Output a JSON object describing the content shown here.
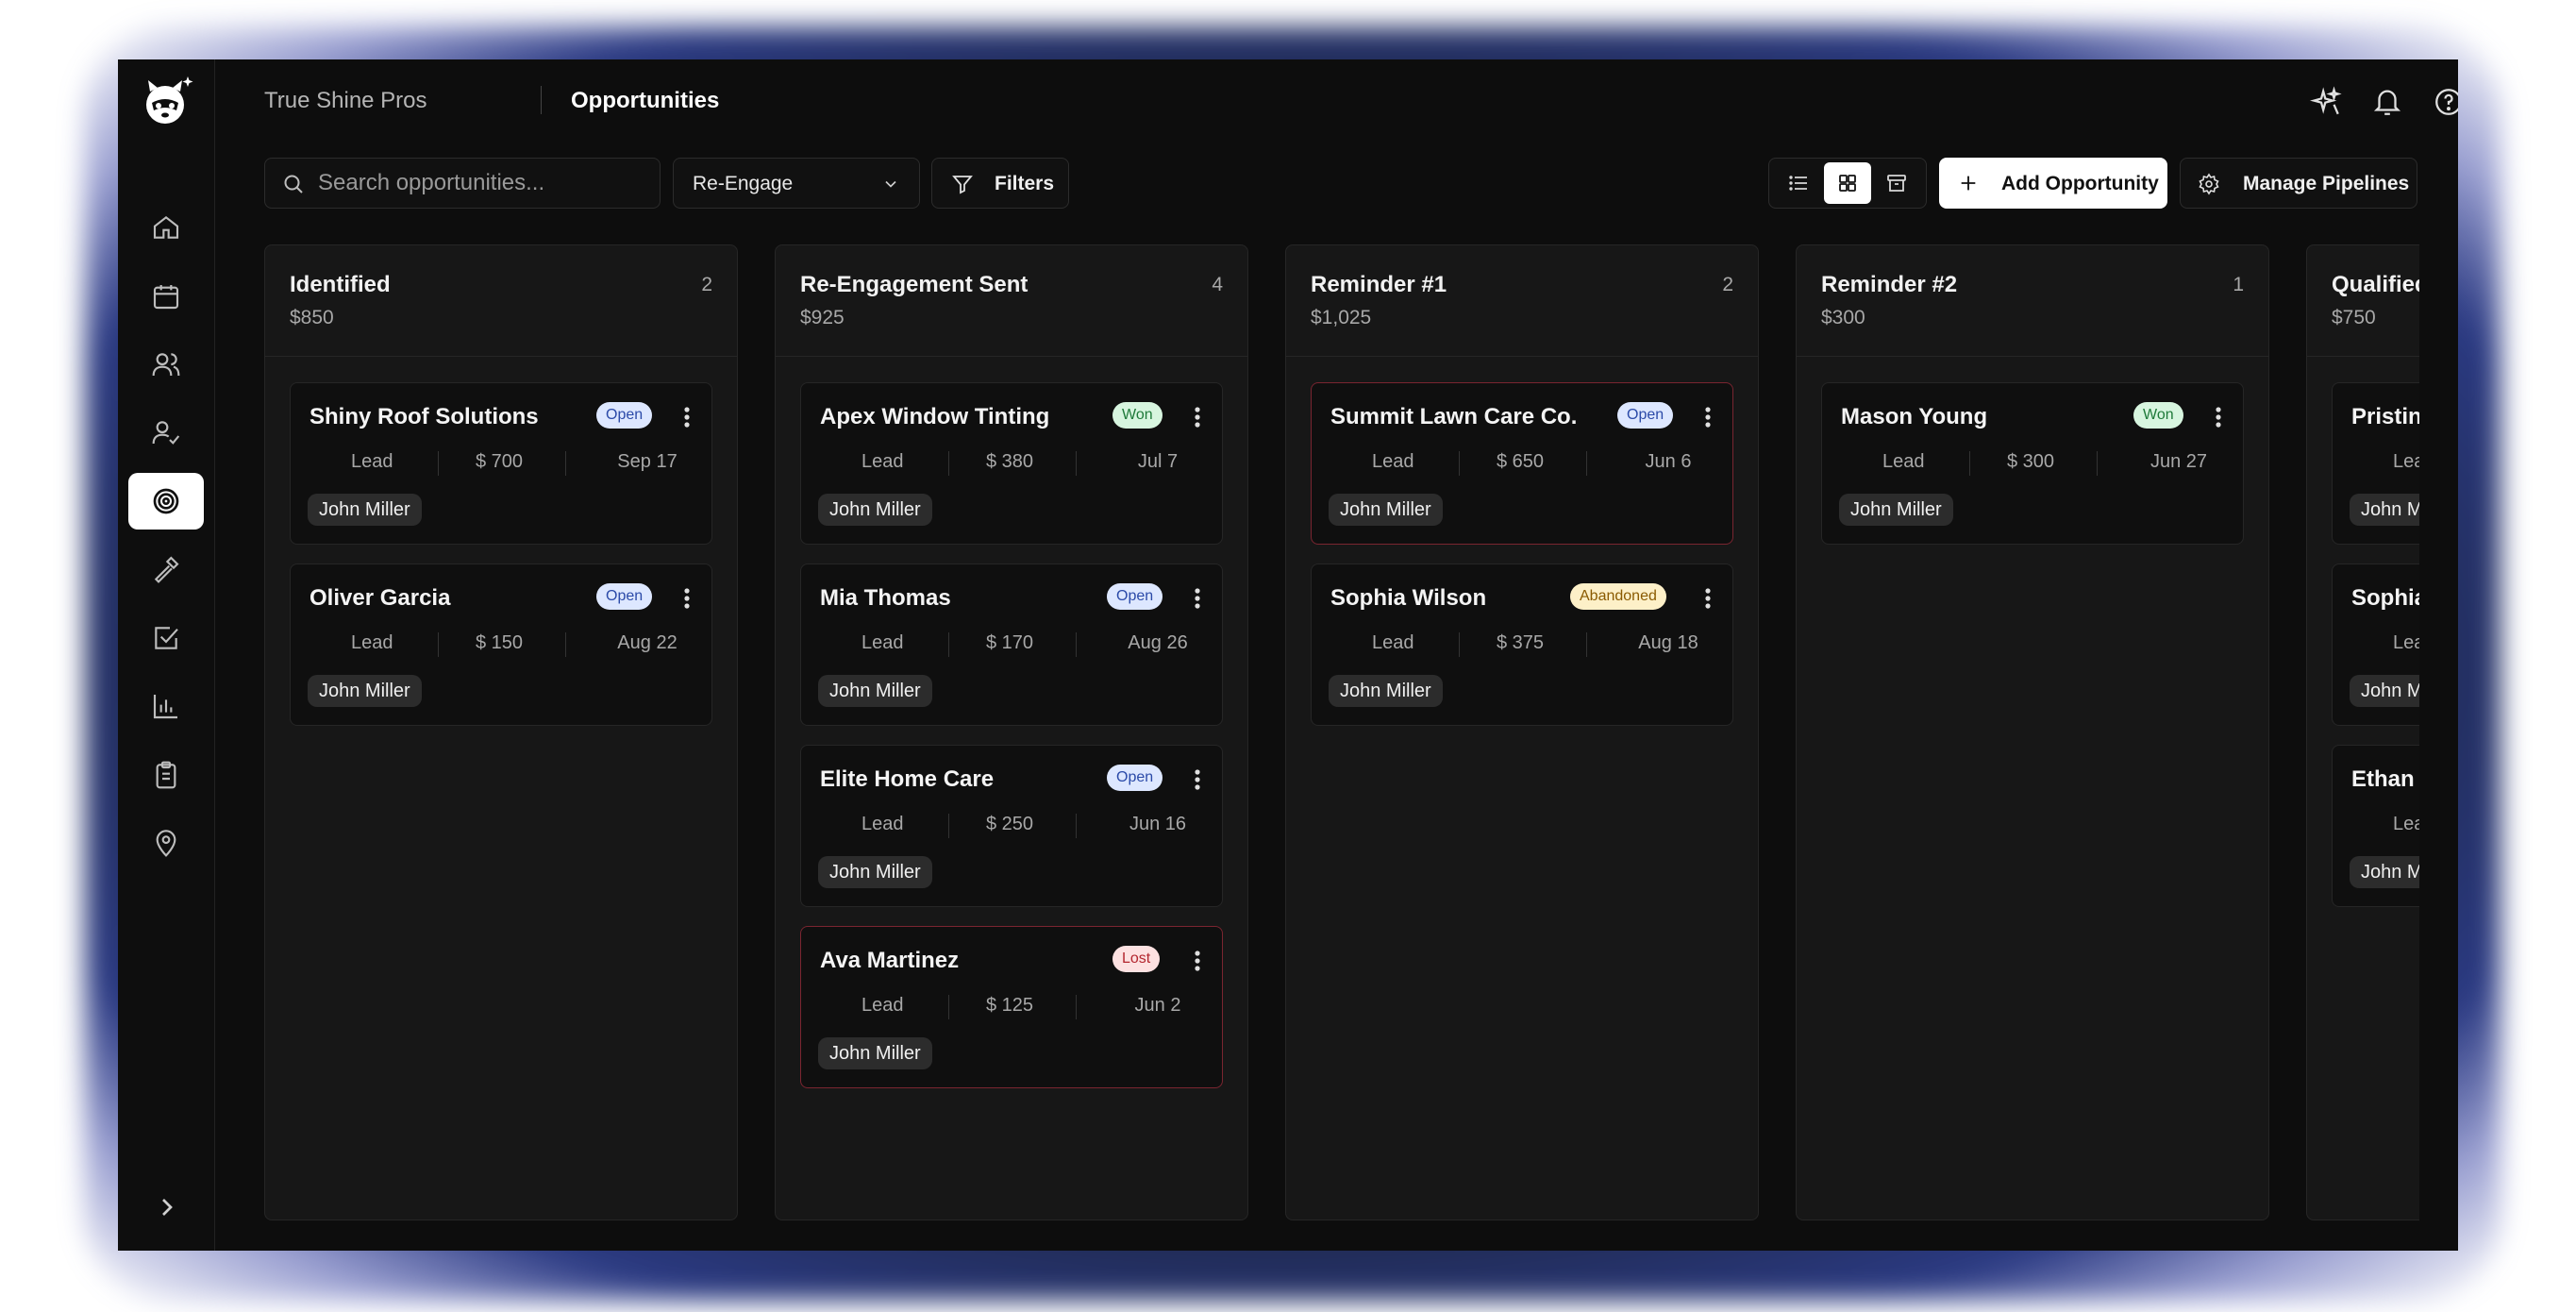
{
  "header": {
    "org": "True Shine Pros",
    "page": "Opportunities"
  },
  "toolbar": {
    "search_placeholder": "Search opportunities...",
    "pipeline": "Re-Engage",
    "filters_label": "Filters",
    "add_label": "Add Opportunity",
    "manage_label": "Manage Pipelines"
  },
  "columns": [
    {
      "title": "Identified",
      "total": "$850",
      "count": "2",
      "cards": [
        {
          "name": "Shiny Roof Solutions",
          "status": "Open",
          "type": "Lead",
          "amount": "$ 700",
          "date": "Sep 17",
          "owner": "John Miller"
        },
        {
          "name": "Oliver Garcia",
          "status": "Open",
          "type": "Lead",
          "amount": "$ 150",
          "date": "Aug 22",
          "owner": "John Miller"
        }
      ]
    },
    {
      "title": "Re-Engagement Sent",
      "total": "$925",
      "count": "4",
      "cards": [
        {
          "name": "Apex Window Tinting",
          "status": "Won",
          "type": "Lead",
          "amount": "$ 380",
          "date": "Jul 7",
          "owner": "John Miller"
        },
        {
          "name": "Mia Thomas",
          "status": "Open",
          "type": "Lead",
          "amount": "$ 170",
          "date": "Aug 26",
          "owner": "John Miller"
        },
        {
          "name": "Elite Home Care",
          "status": "Open",
          "type": "Lead",
          "amount": "$ 250",
          "date": "Jun 16",
          "owner": "John Miller"
        },
        {
          "name": "Ava Martinez",
          "status": "Lost",
          "type": "Lead",
          "amount": "$ 125",
          "date": "Jun 2",
          "owner": "John Miller"
        }
      ]
    },
    {
      "title": "Reminder #1",
      "total": "$1,025",
      "count": "2",
      "cards": [
        {
          "name": "Summit Lawn Care Co.",
          "status": "Open",
          "type": "Lead",
          "amount": "$ 650",
          "date": "Jun 6",
          "owner": "John Miller"
        },
        {
          "name": "Sophia Wilson",
          "status": "Abandoned",
          "type": "Lead",
          "amount": "$ 375",
          "date": "Aug 18",
          "owner": "John Miller"
        }
      ]
    },
    {
      "title": "Reminder #2",
      "total": "$300",
      "count": "1",
      "cards": [
        {
          "name": "Mason Young",
          "status": "Won",
          "type": "Lead",
          "amount": "$ 300",
          "date": "Jun 27",
          "owner": "John Miller"
        }
      ]
    },
    {
      "title": "Qualified",
      "total": "$750",
      "count": "",
      "cards": [
        {
          "name": "Pristine",
          "status": "",
          "type": "Lea",
          "amount": "",
          "date": "",
          "owner": "John M"
        },
        {
          "name": "Sophia",
          "status": "",
          "type": "Lea",
          "amount": "",
          "date": "",
          "owner": "John M"
        },
        {
          "name": "Ethan K",
          "status": "",
          "type": "Lea",
          "amount": "",
          "date": "",
          "owner": "John M"
        }
      ]
    }
  ],
  "icons": {
    "logo": "raccoon-logo-icon",
    "nav": [
      "home-icon",
      "calendar-icon",
      "users-icon",
      "user-check-icon",
      "target-icon",
      "hammer-icon",
      "checkbox-icon",
      "bar-chart-icon",
      "clipboard-icon",
      "map-pin-icon"
    ],
    "header": [
      "sparkle-icon",
      "bell-icon",
      "help-icon",
      "settings-icon"
    ]
  },
  "colors": {
    "background": "#0d0d0d",
    "column": "#171717",
    "card": "#0f0f0f",
    "open_badge": "#dde7ff",
    "won_badge": "#d7f5df",
    "lost_badge": "#fde1e1",
    "abandoned_badge": "#fdf0c8",
    "alert_border": "#7a2530"
  }
}
